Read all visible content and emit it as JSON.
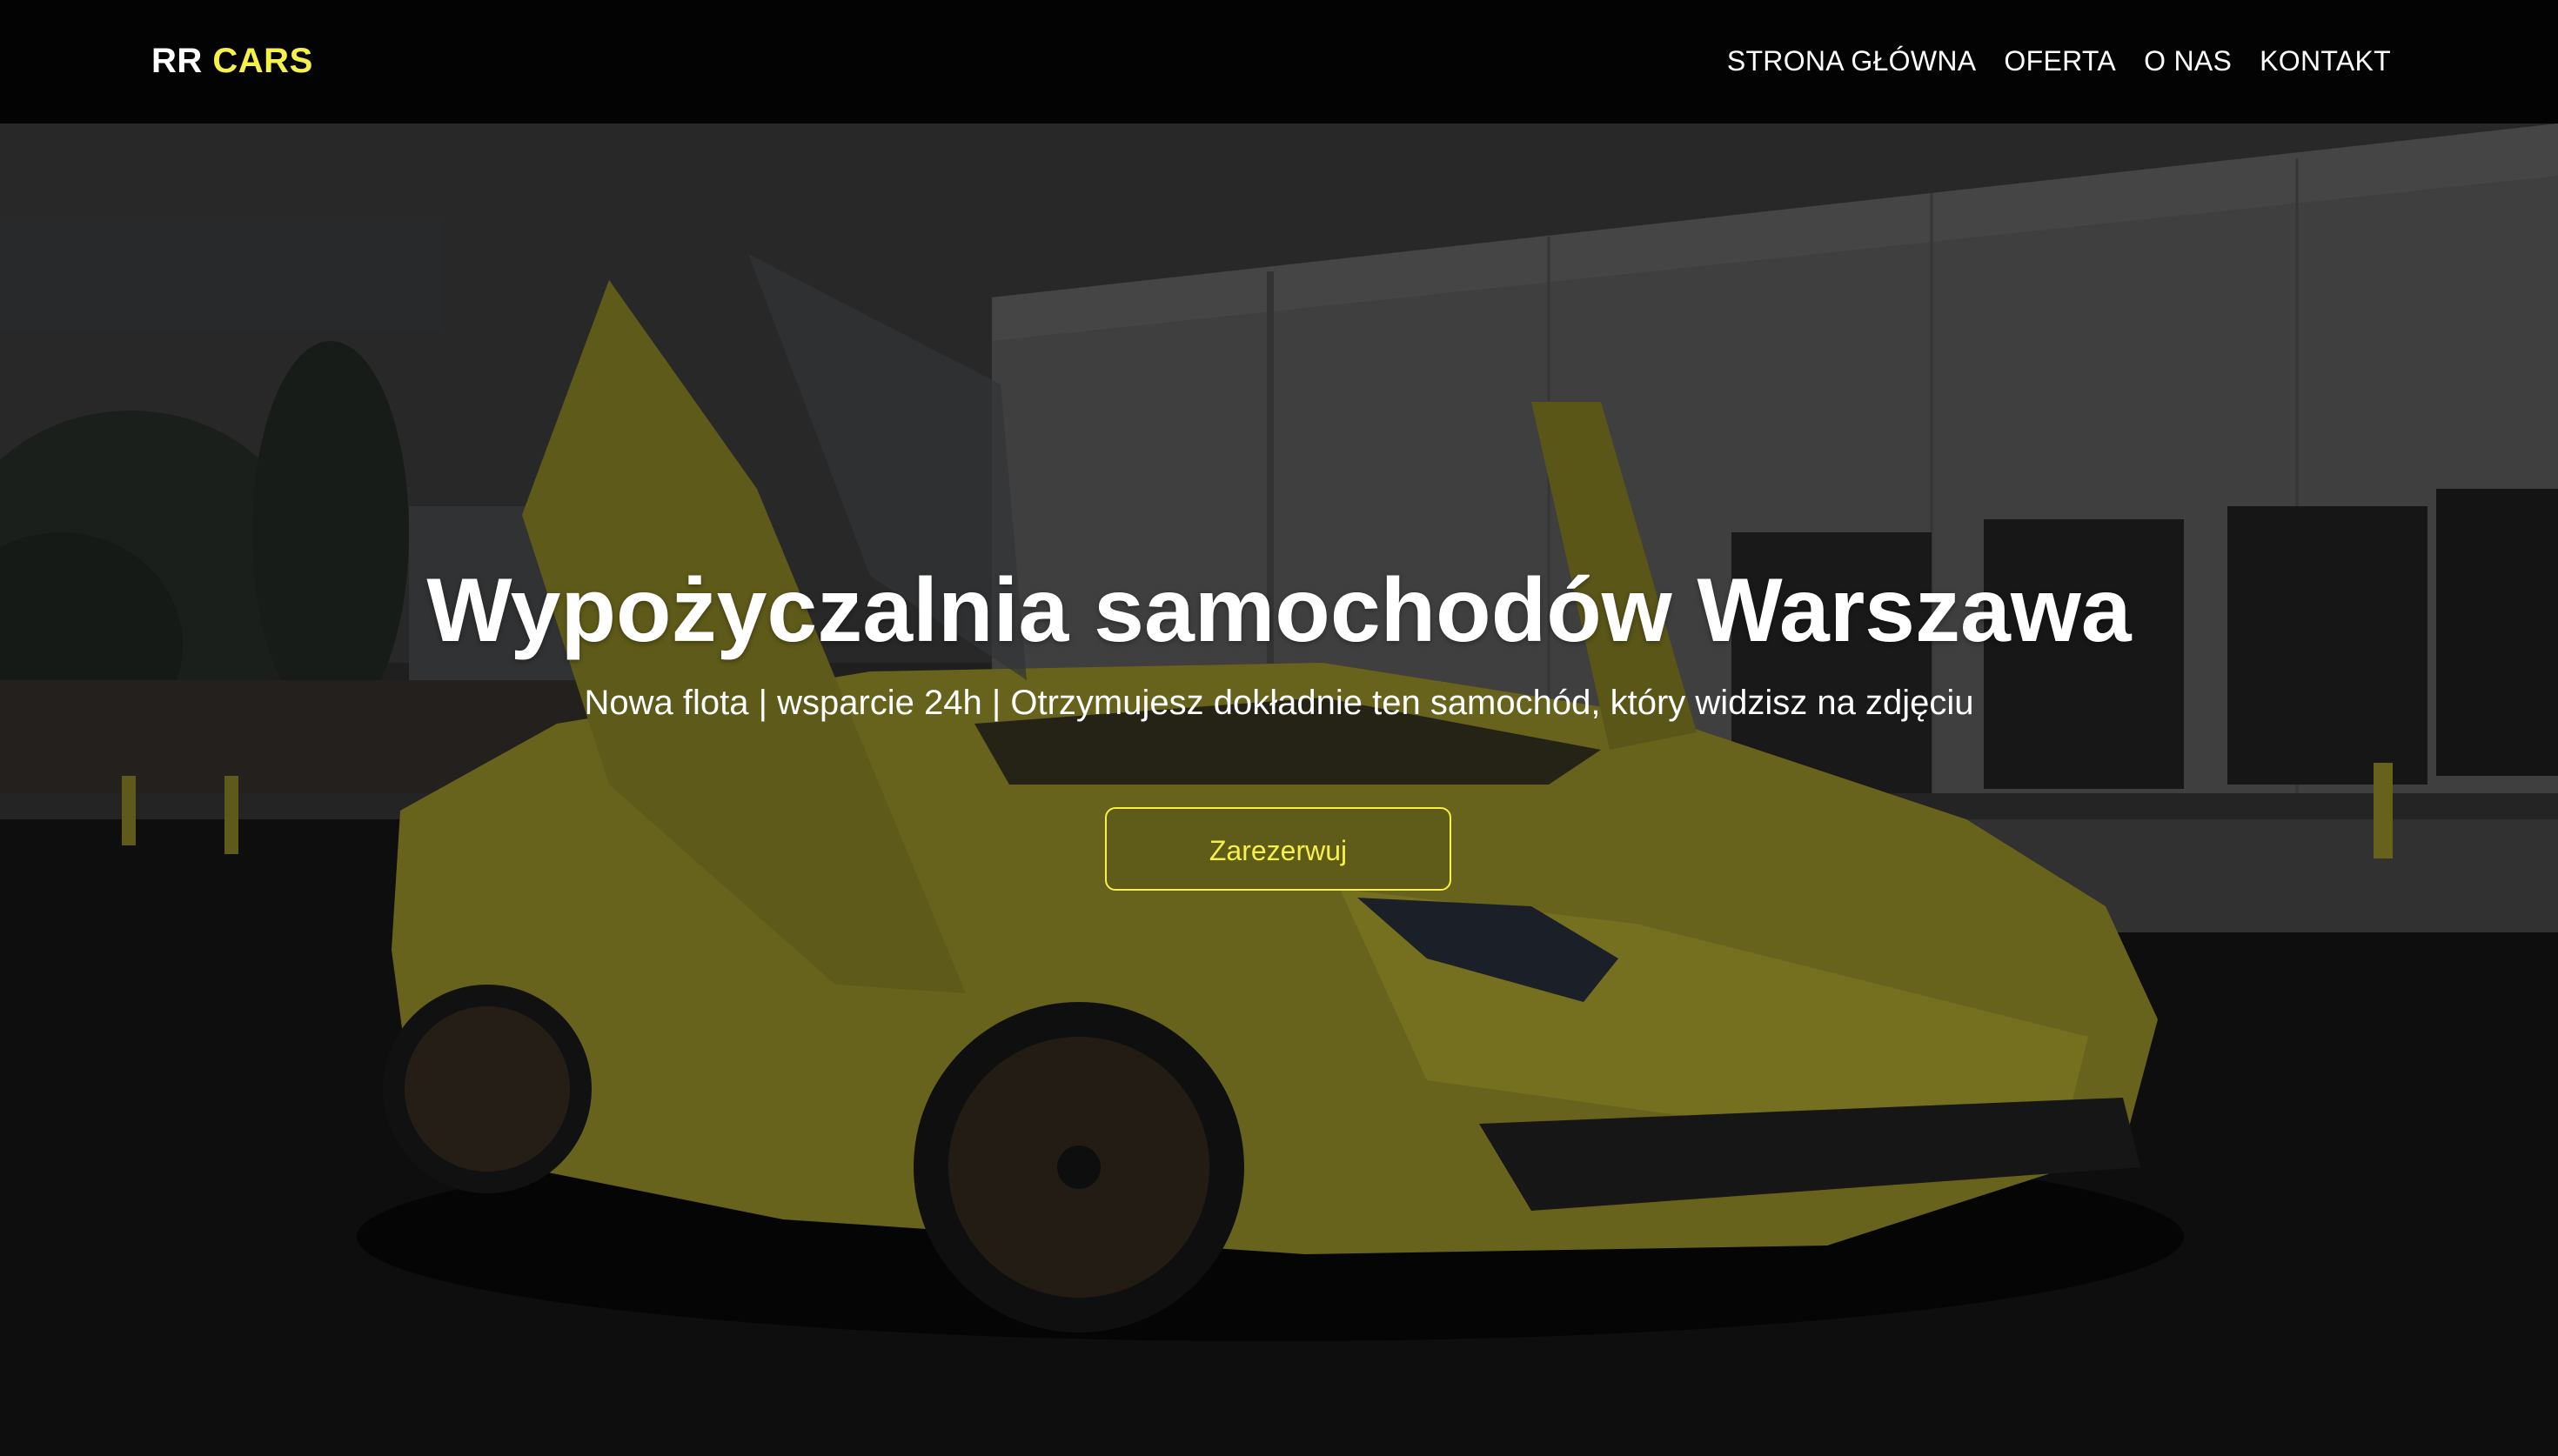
{
  "brand": {
    "part1": "RR",
    "part2": "CARS"
  },
  "nav": {
    "items": [
      {
        "label": "STRONA GŁÓWNA"
      },
      {
        "label": "OFERTA"
      },
      {
        "label": "O NAS"
      },
      {
        "label": "KONTAKT"
      }
    ]
  },
  "hero": {
    "title": "Wypożyczalnia samochodów Warszawa",
    "subtitle": "Nowa flota | wsparcie 24h | Otrzymujesz dokładnie ten samochód, który widzisz na zdjęciu",
    "cta_label": "Zarezerwuj",
    "background": "yellow-supercar-photo"
  },
  "colors": {
    "accent": "#f6f04a",
    "header_bg": "#030303",
    "text": "#ffffff"
  }
}
